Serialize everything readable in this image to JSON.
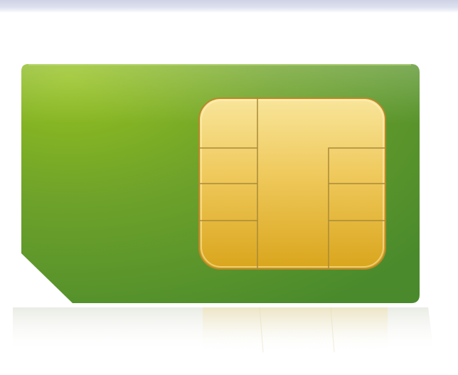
{
  "image": {
    "subject": "sim-card-icon",
    "colors": {
      "card_light": "#95c11f",
      "card_mid": "#6ea22a",
      "card_dark": "#4a8a2c",
      "chip_light": "#f8e59a",
      "chip_mid": "#efc95c",
      "chip_dark": "#d9a51c",
      "chip_outline": "#b8892a",
      "top_strip": "#cdd2e4",
      "background": "#ffffff"
    }
  }
}
